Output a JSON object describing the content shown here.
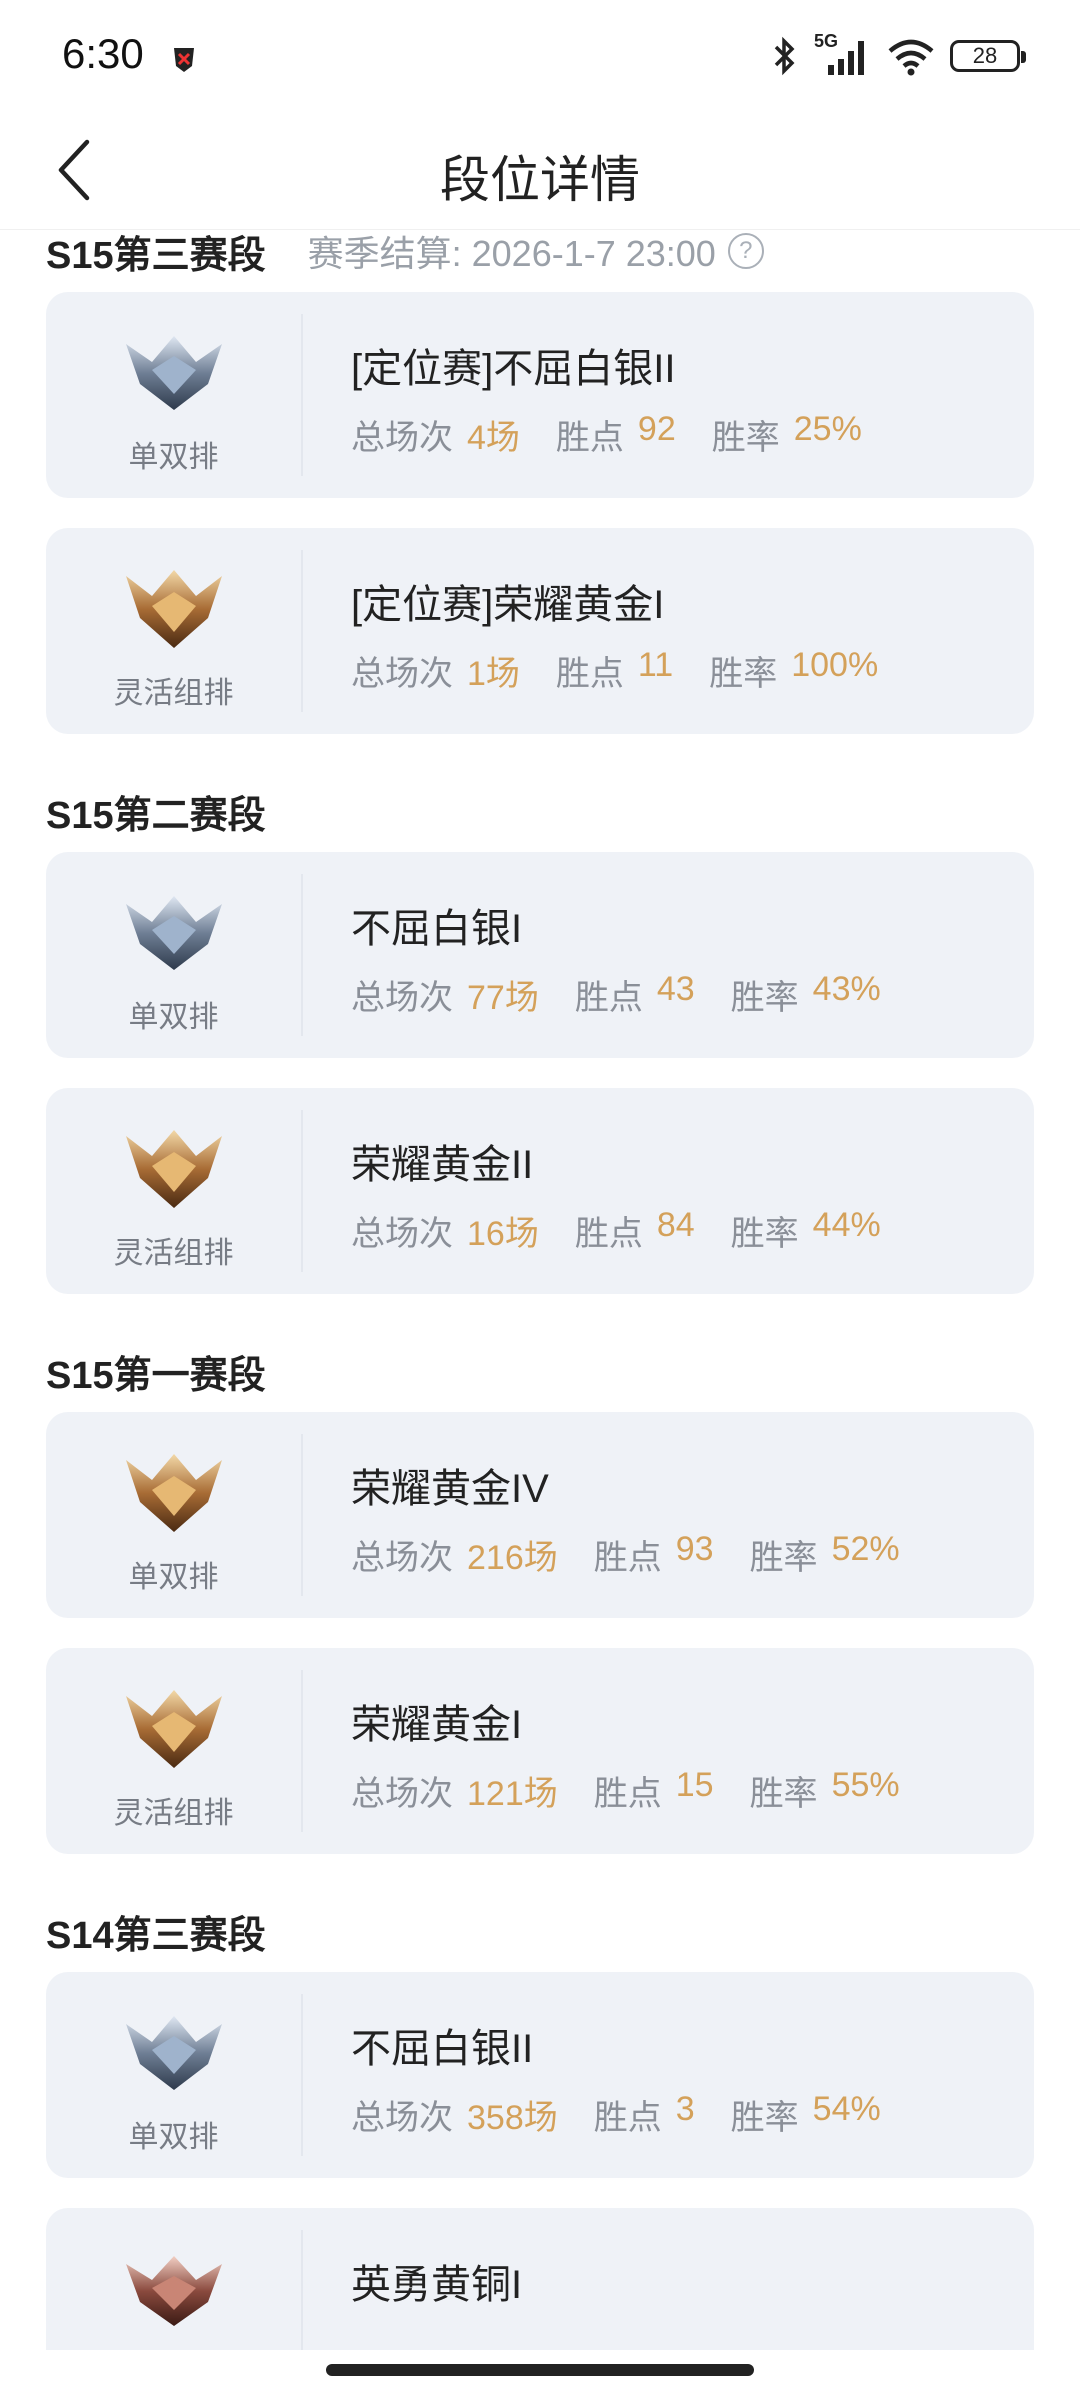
{
  "status_bar": {
    "time": "6:30",
    "network": "5G",
    "battery": "28"
  },
  "header": {
    "title": "段位详情",
    "back_icon": "chevron-left-icon"
  },
  "labels": {
    "total": "总场次",
    "points": "胜点",
    "winrate": "胜率"
  },
  "seasons": [
    {
      "title": "S15第三赛段",
      "end_text": "赛季结算: 2026-1-7 23:00",
      "help_icon": "?",
      "cards": [
        {
          "queue": "单双排",
          "tier": "silver",
          "rank": "[定位赛]不屈白银II",
          "games": "4场",
          "points": "92",
          "winrate": "25%"
        },
        {
          "queue": "灵活组排",
          "tier": "gold",
          "rank": "[定位赛]荣耀黄金I",
          "games": "1场",
          "points": "11",
          "winrate": "100%"
        }
      ]
    },
    {
      "title": "S15第二赛段",
      "cards": [
        {
          "queue": "单双排",
          "tier": "silver",
          "rank": "不屈白银I",
          "games": "77场",
          "points": "43",
          "winrate": "43%"
        },
        {
          "queue": "灵活组排",
          "tier": "gold",
          "rank": "荣耀黄金II",
          "games": "16场",
          "points": "84",
          "winrate": "44%"
        }
      ]
    },
    {
      "title": "S15第一赛段",
      "cards": [
        {
          "queue": "单双排",
          "tier": "gold",
          "rank": "荣耀黄金IV",
          "games": "216场",
          "points": "93",
          "winrate": "52%"
        },
        {
          "queue": "灵活组排",
          "tier": "gold",
          "rank": "荣耀黄金I",
          "games": "121场",
          "points": "15",
          "winrate": "55%"
        }
      ]
    },
    {
      "title": "S14第三赛段",
      "cards": [
        {
          "queue": "单双排",
          "tier": "silver",
          "rank": "不屈白银II",
          "games": "358场",
          "points": "3",
          "winrate": "54%"
        },
        {
          "queue": "",
          "tier": "bronze",
          "rank": "英勇黄铜I",
          "games": "",
          "points": "",
          "winrate": ""
        }
      ]
    }
  ],
  "colors": {
    "accent": "#d4a15a",
    "card_bg": "#eff2f7",
    "muted": "#8a8f98"
  }
}
